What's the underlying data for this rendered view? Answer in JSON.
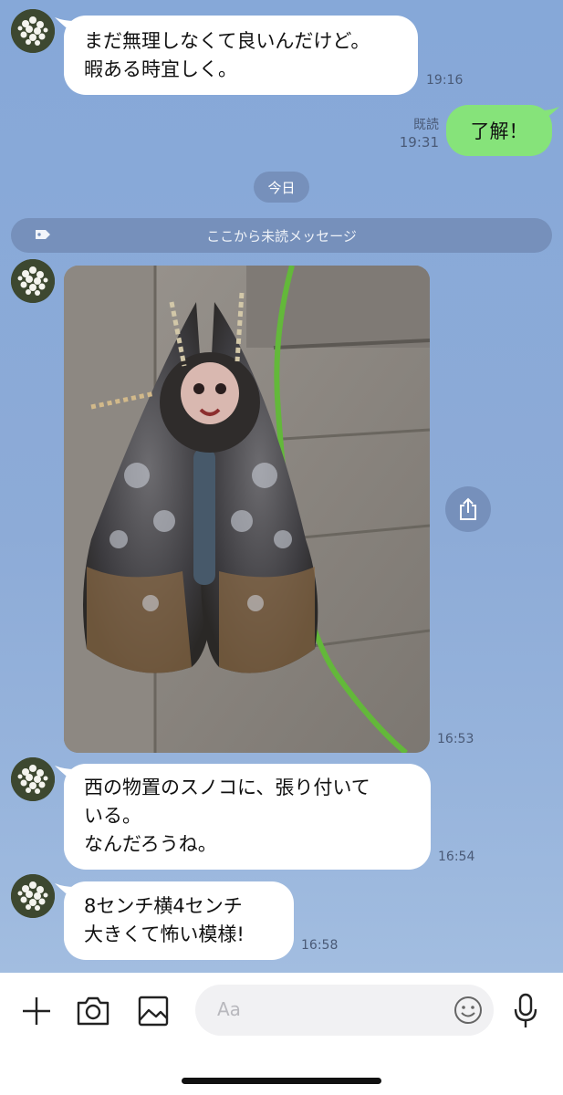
{
  "messages": [
    {
      "id": "m1",
      "lines": [
        "まだ無理しなくて良いんだけど。",
        "暇ある時宜しく。"
      ],
      "time": "19:16"
    },
    {
      "id": "m2",
      "lines": [
        "西の物置のスノコに、張り付いて",
        "いる。",
        "なんだろうね。"
      ],
      "time": "16:54"
    },
    {
      "id": "m3",
      "lines": [
        "8センチ横4センチ",
        "大きくて怖い模様!"
      ],
      "time": "16:58"
    }
  ],
  "outgoing": {
    "text": "了解！",
    "read_label": "既読",
    "time": "19:31"
  },
  "date_separator": "今日",
  "unread_separator": "ここから未読メッセージ",
  "photo_message": {
    "time": "16:53",
    "subject": "moth photo"
  },
  "input_bar": {
    "placeholder": "Aa",
    "icons": [
      "plus-icon",
      "camera-icon",
      "image-icon",
      "emoji-icon",
      "microphone-icon"
    ]
  },
  "colors": {
    "chat_background": "#8aa9d6",
    "outgoing_bubble": "#86e37a",
    "incoming_bubble": "#ffffff",
    "chip": "#7690bb"
  }
}
